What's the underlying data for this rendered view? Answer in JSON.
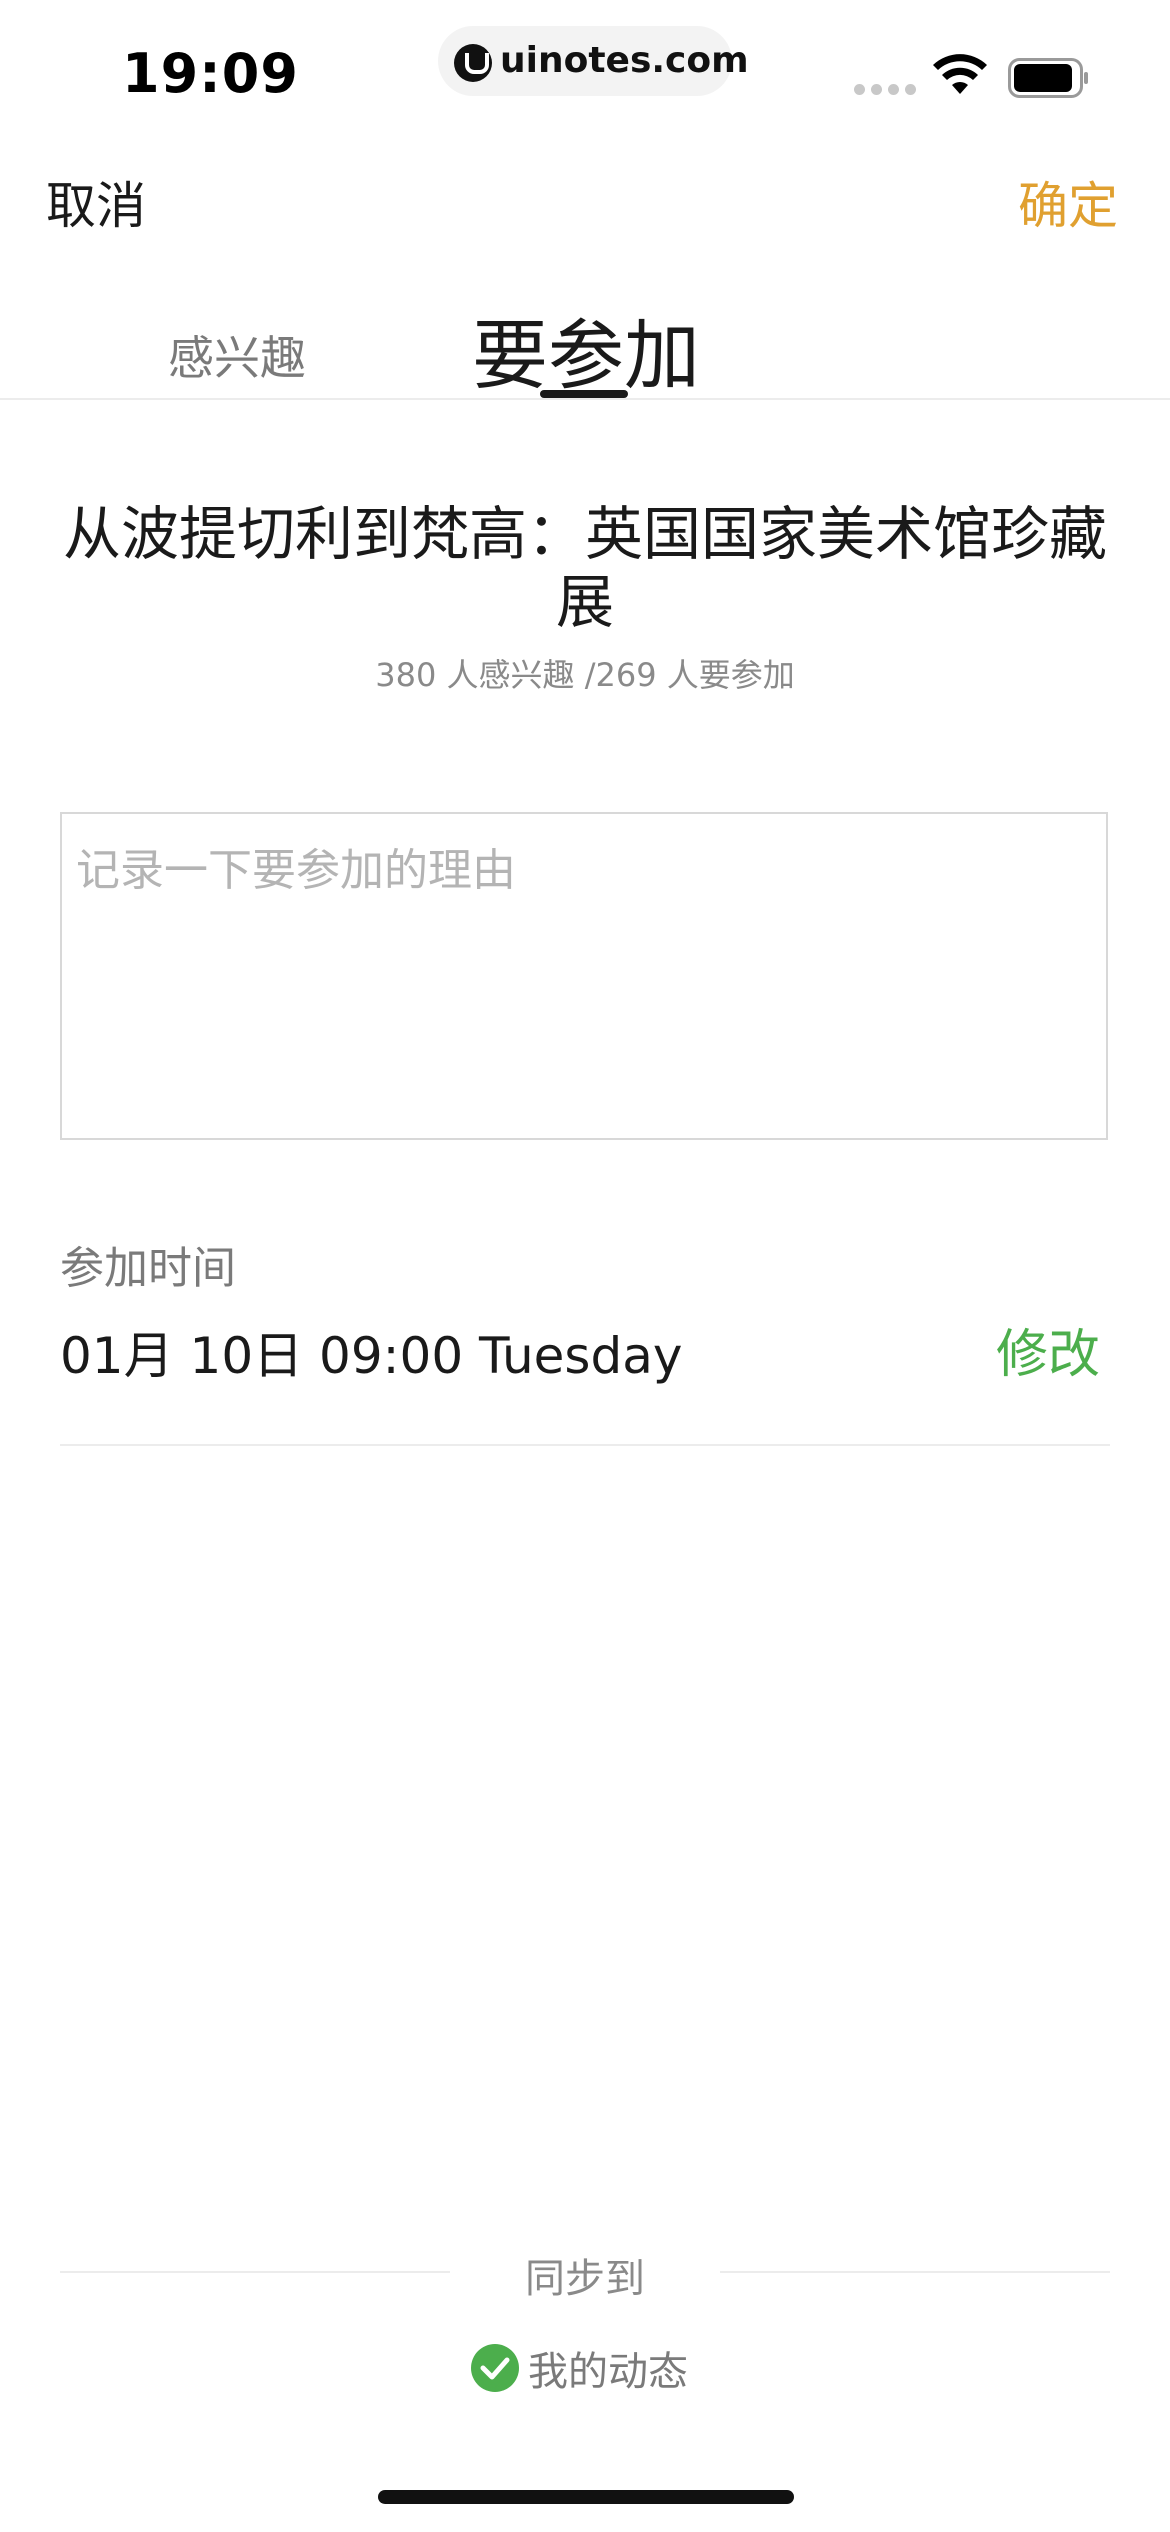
{
  "status_bar": {
    "time": "19:09",
    "url": "uinotes.com"
  },
  "nav": {
    "cancel_label": "取消",
    "confirm_label": "确定"
  },
  "tabs": {
    "interested_label": "感兴趣",
    "attend_label": "要参加",
    "active": "attend"
  },
  "event": {
    "title": "从波提切利到梵高：英国国家美术馆珍藏展",
    "stats": "380 人感兴趣 /269 人要参加"
  },
  "reason": {
    "value": "",
    "placeholder": "记录一下要参加的理由"
  },
  "attend_time": {
    "label": "参加时间",
    "value": "01月 10日 09:00 Tuesday",
    "modify_label": "修改"
  },
  "sync": {
    "label": "同步到",
    "option_label": "我的动态",
    "option_checked": true
  },
  "colors": {
    "accent_confirm": "#e0a030",
    "accent_green": "#4cae4c",
    "text_primary": "#1a1a1a",
    "text_secondary": "#7a7a7a"
  },
  "icons": {
    "url_logo": "uinotes-logo-icon",
    "wifi": "wifi-icon",
    "battery": "battery-icon",
    "check": "check-circle-icon"
  }
}
